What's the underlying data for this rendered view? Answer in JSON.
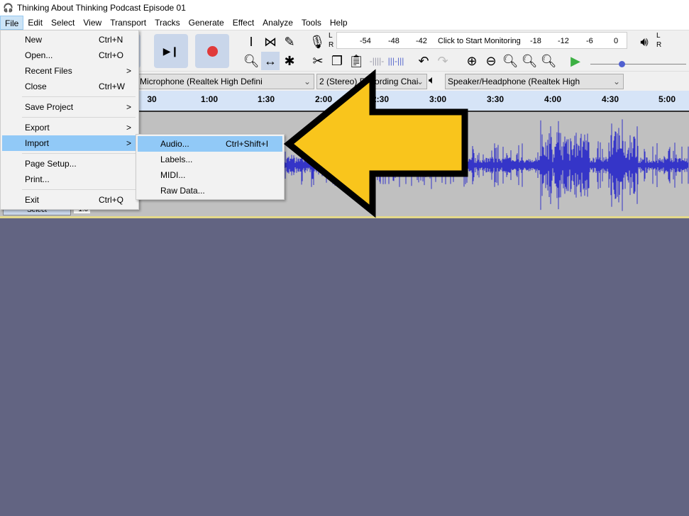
{
  "window": {
    "title": "Thinking About Thinking Podcast Episode 01"
  },
  "menubar": [
    "File",
    "Edit",
    "Select",
    "View",
    "Transport",
    "Tracks",
    "Generate",
    "Effect",
    "Analyze",
    "Tools",
    "Help"
  ],
  "meter": {
    "labels": [
      "-54",
      "-48",
      "-42",
      "Click to Start Monitoring",
      "-18",
      "-12",
      "-6",
      "0"
    ],
    "L": "L",
    "R": "R"
  },
  "devices": {
    "input": "Microphone (Realtek High Defini",
    "channels": "2 (Stereo) Recording Chai",
    "output": "Speaker/Headphone (Realtek High"
  },
  "ruler": [
    "30",
    "1:00",
    "1:30",
    "2:00",
    "2:30",
    "3:00",
    "3:30",
    "4:00",
    "4:30",
    "5:00"
  ],
  "track": {
    "select_label": "Select",
    "scale": "-1.0"
  },
  "file_menu": [
    {
      "label": "New",
      "shortcut": "Ctrl+N"
    },
    {
      "label": "Open...",
      "shortcut": "Ctrl+O"
    },
    {
      "label": "Recent Files",
      "submenu": ">"
    },
    {
      "label": "Close",
      "shortcut": "Ctrl+W"
    },
    {
      "label": "Save Project",
      "submenu": ">"
    },
    {
      "label": "Export",
      "submenu": ">"
    },
    {
      "label": "Import",
      "submenu": ">"
    },
    {
      "label": "Page Setup..."
    },
    {
      "label": "Print..."
    },
    {
      "label": "Exit",
      "shortcut": "Ctrl+Q"
    }
  ],
  "import_menu": [
    {
      "label": "Audio...",
      "shortcut": "Ctrl+Shift+I"
    },
    {
      "label": "Labels..."
    },
    {
      "label": "MIDI..."
    },
    {
      "label": "Raw Data..."
    }
  ],
  "colors": {
    "waveform": "#3535c8",
    "arrow": "#f9c51c",
    "highlight": "#91c9f7"
  }
}
